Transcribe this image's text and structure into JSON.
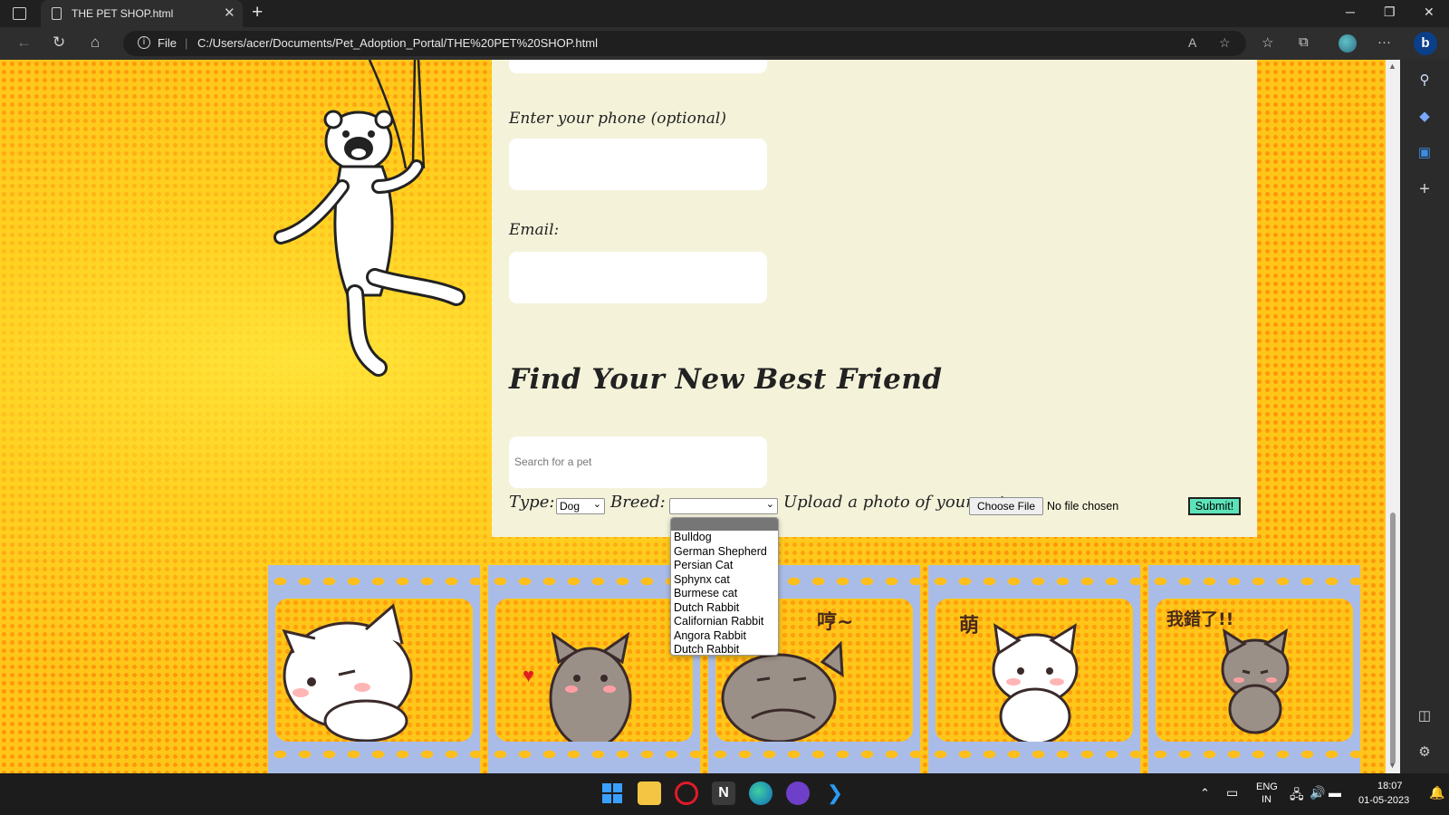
{
  "browser": {
    "tab_title": "THE PET SHOP.html",
    "address_scheme": "File",
    "address_url": "C:/Users/acer/Documents/Pet_Adoption_Portal/THE%20PET%20SHOP.html"
  },
  "form": {
    "phone_label": "Enter your phone (optional)",
    "email_label": "Email:",
    "find_title": "Find Your New Best Friend",
    "search_placeholder": "Search for a pet",
    "type_label": "Type:",
    "type_value": "Dog",
    "breed_label": "Breed:",
    "breed_value": "",
    "upload_label": "Upload a photo of your pet:",
    "choose_file_label": "Choose File",
    "no_file_text": "No file chosen",
    "submit_label": "Submit!"
  },
  "breed_options": [
    "Bulldog",
    "German Shepherd",
    "Persian Cat",
    "Sphynx cat",
    "Burmese cat",
    "Dutch Rabbit",
    "Californian Rabbit",
    "Angora Rabbit",
    "Dutch Rabbit"
  ],
  "stickers": {
    "frame3_caption": "哼~",
    "frame4_caption": "萌",
    "frame5_caption": "我錯了!!"
  },
  "taskbar": {
    "lang_top": "ENG",
    "lang_bottom": "IN",
    "time": "18:07",
    "date": "01-05-2023"
  },
  "colors": {
    "page_bg": "#ffc61a",
    "panel_bg": "#f4f3da",
    "submit_bg": "#5de3b8",
    "film_frame": "#a9bce8"
  }
}
